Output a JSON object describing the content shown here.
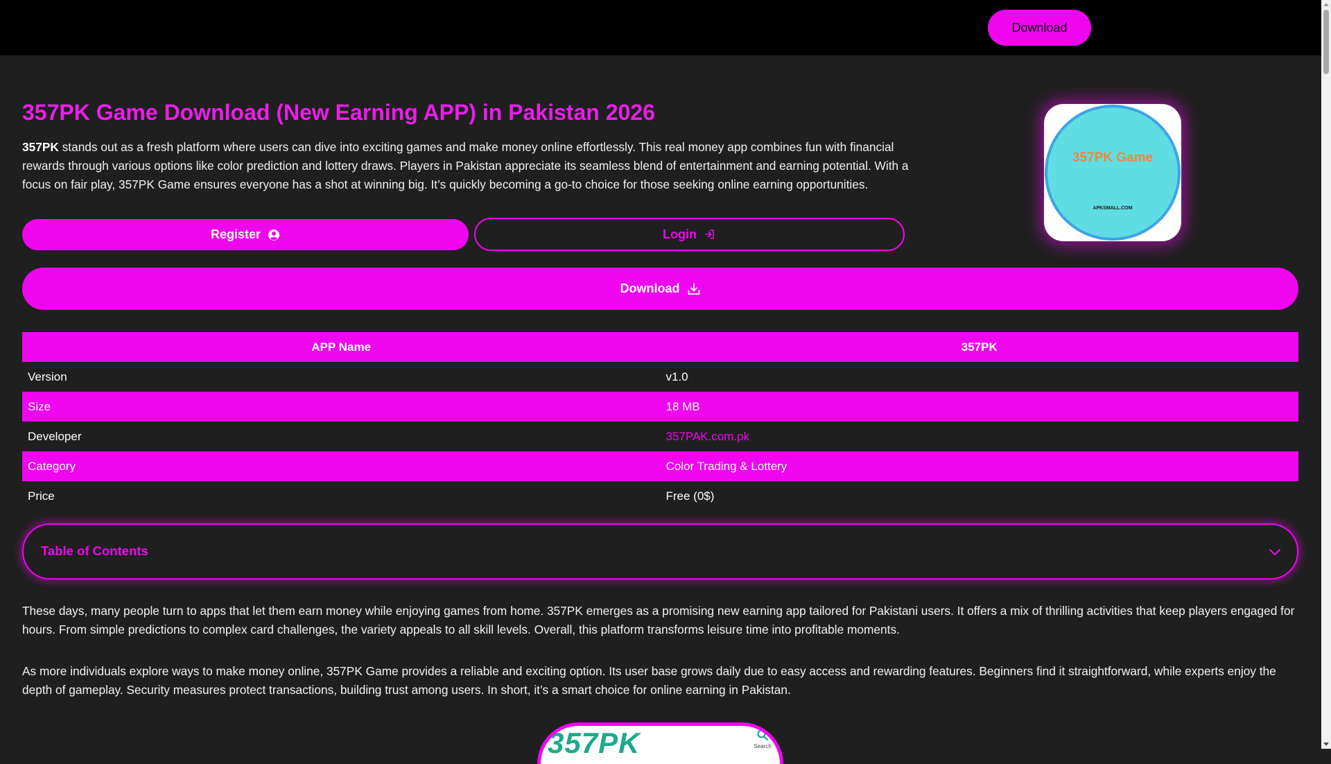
{
  "header": {
    "download_label": "Download"
  },
  "main": {
    "title": "357PK Game Download (New Earning APP) in Pakistan 2026",
    "intro_bold": "357PK",
    "intro_text": " stands out as a fresh platform where users can dive into exciting games and make money online effortlessly. This real money app combines fun with financial rewards through various options like color prediction and lottery draws. Players in Pakistan appreciate its seamless blend of entertainment and earning potential. With a focus on fair play, 357PK Game ensures everyone has a shot at winning big. It’s quickly becoming a go-to choice for those seeking online earning opportunities.",
    "app_icon": {
      "title": "357PK Game",
      "subtitle": "APKSMALL.COM"
    },
    "buttons": {
      "register": "Register",
      "login": "Login",
      "download": "Download"
    },
    "info_table": {
      "header": [
        "APP Name",
        "357PK"
      ],
      "rows": [
        {
          "label": "Version",
          "value": "v1.0"
        },
        {
          "label": "Size",
          "value": "18 MB"
        },
        {
          "label": "Developer",
          "value": "357PAK.com.pk"
        },
        {
          "label": "Category",
          "value": "Color Trading & Lottery"
        },
        {
          "label": "Price",
          "value": "Free (0$)"
        }
      ]
    },
    "toc": {
      "title": "Table of Contents"
    },
    "paragraphs": [
      "These days, many people turn to apps that let them earn money while enjoying games from home. 357PK emerges as a promising new earning app tailored for Pakistani users. It offers a mix of thrilling activities that keep players engaged for hours. From simple predictions to complex card challenges, the variety appeals to all skill levels. Overall, this platform transforms leisure time into profitable moments.",
      "As more individuals explore ways to make money online, 357PK Game provides a reliable and exciting option. Its user base grows daily due to easy access and rewarding features. Beginners find it straightforward, while experts enjoy the depth of gameplay. Security measures protect transactions, building trust among users. In short, it’s a smart choice for online earning in Pakistan."
    ],
    "screenshot": {
      "logo_text": "357PK",
      "search_label": "Search"
    }
  },
  "icons": {
    "register": "user-circle-icon",
    "login": "sign-in-icon",
    "download": "download-icon",
    "toc": "chevron-down-icon",
    "search": "search-icon"
  },
  "colors": {
    "accent": "#ef06ef",
    "background": "#1f1f1f",
    "topbar": "#000000"
  }
}
